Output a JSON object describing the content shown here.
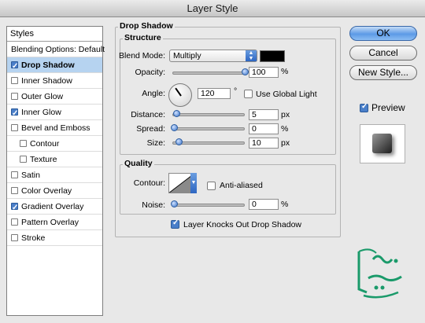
{
  "window": {
    "title": "Layer Style"
  },
  "styles_panel": {
    "header": "Styles",
    "items": [
      {
        "label": "Blending Options: Default",
        "checkbox": false,
        "checked": false,
        "selected": false,
        "sub": false
      },
      {
        "label": "Drop Shadow",
        "checkbox": true,
        "checked": true,
        "selected": true,
        "sub": false
      },
      {
        "label": "Inner Shadow",
        "checkbox": true,
        "checked": false,
        "selected": false,
        "sub": false
      },
      {
        "label": "Outer Glow",
        "checkbox": true,
        "checked": false,
        "selected": false,
        "sub": false
      },
      {
        "label": "Inner Glow",
        "checkbox": true,
        "checked": true,
        "selected": false,
        "sub": false
      },
      {
        "label": "Bevel and Emboss",
        "checkbox": true,
        "checked": false,
        "selected": false,
        "sub": false
      },
      {
        "label": "Contour",
        "checkbox": true,
        "checked": false,
        "selected": false,
        "sub": true
      },
      {
        "label": "Texture",
        "checkbox": true,
        "checked": false,
        "selected": false,
        "sub": true
      },
      {
        "label": "Satin",
        "checkbox": true,
        "checked": false,
        "selected": false,
        "sub": false
      },
      {
        "label": "Color Overlay",
        "checkbox": true,
        "checked": false,
        "selected": false,
        "sub": false
      },
      {
        "label": "Gradient Overlay",
        "checkbox": true,
        "checked": true,
        "selected": false,
        "sub": false
      },
      {
        "label": "Pattern Overlay",
        "checkbox": true,
        "checked": false,
        "selected": false,
        "sub": false
      },
      {
        "label": "Stroke",
        "checkbox": true,
        "checked": false,
        "selected": false,
        "sub": false
      }
    ]
  },
  "drop_shadow": {
    "title": "Drop Shadow",
    "structure": {
      "title": "Structure",
      "blend_mode_label": "Blend Mode:",
      "blend_mode_value": "Multiply",
      "shadow_color": "#000000",
      "opacity_label": "Opacity:",
      "opacity_value": "100",
      "opacity_unit": "%",
      "opacity_level": 1.0,
      "angle_label": "Angle:",
      "angle_value": "120",
      "angle_unit": "°",
      "use_global_light_label": "Use Global Light",
      "use_global_light_checked": false,
      "distance_label": "Distance:",
      "distance_value": "5",
      "distance_unit": "px",
      "spread_label": "Spread:",
      "spread_value": "0",
      "spread_unit": "%",
      "size_label": "Size:",
      "size_value": "10",
      "size_unit": "px"
    },
    "quality": {
      "title": "Quality",
      "contour_label": "Contour:",
      "anti_aliased_label": "Anti-aliased",
      "anti_aliased_checked": false,
      "noise_label": "Noise:",
      "noise_value": "0",
      "noise_unit": "%"
    },
    "knockout_label": "Layer Knocks Out Drop Shadow",
    "knockout_checked": true
  },
  "buttons": {
    "ok": "OK",
    "cancel": "Cancel",
    "new_style": "New Style...",
    "preview_label": "Preview",
    "preview_checked": true
  },
  "colors": {
    "accent": "#4a7fc9",
    "selection": "#b6d3f0",
    "logo": "#1a9a6a"
  }
}
